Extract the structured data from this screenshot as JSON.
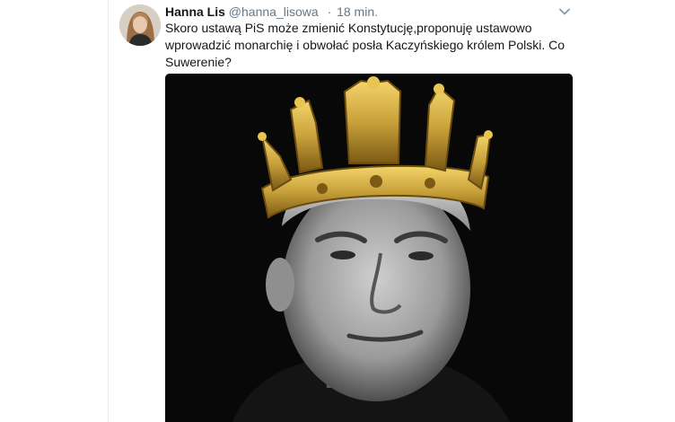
{
  "tweet": {
    "author_name": "Hanna Lis",
    "author_handle": "@hanna_lisowa",
    "separator": "·",
    "timestamp": "18 min.",
    "text": "Skoro ustawą PiS może zmienić Konstytucję,proponuję ustawowo wprowadzić monarchię i obwołać posła Kaczyńskiego królem Polski. Co Suwerenie?"
  },
  "icons": {
    "menu": "chevron-down-icon",
    "avatar": "profile-photo",
    "media": "photo-man-with-crown"
  },
  "colors": {
    "text": "#14171a",
    "secondary": "#657786",
    "border": "#e6ecf0",
    "media_bg": "#080808",
    "crown_gold": "#c9a03a"
  }
}
